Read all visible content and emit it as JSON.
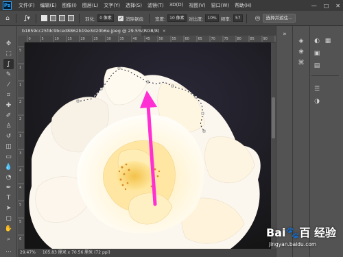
{
  "app": {
    "logo": "Ps"
  },
  "menu": {
    "items": [
      "文件(F)",
      "编辑(E)",
      "图像(I)",
      "图层(L)",
      "文字(Y)",
      "选择(S)",
      "滤镜(T)",
      "3D(D)",
      "视图(V)",
      "窗口(W)",
      "帮助(H)"
    ]
  },
  "window_controls": {
    "minimize": "—",
    "maximize": "□",
    "close": "✕"
  },
  "options": {
    "feather_label": "羽化:",
    "feather_value": "0 像素",
    "antialias_label": "消除锯齿",
    "antialias_checked": true,
    "width_label": "宽度:",
    "width_value": "10 像素",
    "contrast_label": "对比度:",
    "contrast_value": "10%",
    "frequency_label": "频率:",
    "frequency_value": "57",
    "select_mask_button": "选择并遮住..."
  },
  "document": {
    "tab_title": "b1859cc25fdc9bced8862b19e3d20b6e.jpeg @ 29.5%(RGB/8)",
    "close_glyph": "×"
  },
  "status": {
    "zoom": "29.47%",
    "dimensions": "105.83 厘米 x 70.56 厘米 (72 ppi)"
  },
  "ruler": {
    "h_labels": [
      "0",
      "5",
      "10",
      "15",
      "20",
      "25",
      "30",
      "35",
      "40",
      "45",
      "50",
      "55",
      "60",
      "65",
      "70",
      "75",
      "80",
      "85",
      "90",
      "95"
    ],
    "v_labels": [
      "5",
      "1",
      "1",
      "2",
      "2",
      "3",
      "3",
      "4",
      "4",
      "5",
      "5",
      "6"
    ]
  },
  "icons": {
    "tools": [
      "move-icon",
      "marquee-icon",
      "magnetic-lasso-icon",
      "quick-select-icon",
      "crop-icon",
      "eyedropper-icon",
      "healing-brush-icon",
      "brush-icon",
      "clone-stamp-icon",
      "history-brush-icon",
      "eraser-icon",
      "gradient-icon",
      "blur-icon",
      "dodge-icon",
      "pen-icon",
      "type-icon",
      "path-select-icon",
      "shape-icon",
      "hand-icon",
      "zoom-icon"
    ]
  },
  "watermark": {
    "logo": "Bai🐾百 经验",
    "url": "jingyan.baidu.com"
  },
  "colors": {
    "arrow": "#ff2fd4",
    "accent": "#31a8ff"
  }
}
